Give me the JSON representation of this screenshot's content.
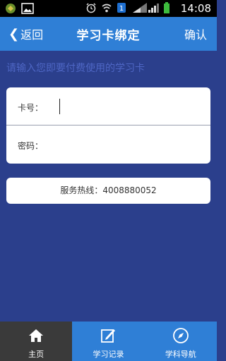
{
  "status_bar": {
    "time": "14:08",
    "icons": [
      "usb-debug-icon",
      "image-notification-icon",
      "alarm-icon",
      "wifi-icon",
      "notification-badge-icon",
      "signal-icon",
      "battery-icon"
    ]
  },
  "nav": {
    "back_label": "返回",
    "title": "学习卡绑定",
    "confirm_label": "确认"
  },
  "hint": "请输入您即要付费使用的学习卡",
  "form": {
    "card_label": "卡号：",
    "card_value": "",
    "password_label": "密码：",
    "password_value": ""
  },
  "hotline": "服务热线：4008880052",
  "tabs": [
    {
      "label": "主页",
      "icon": "home-icon",
      "active": true
    },
    {
      "label": "学习记录",
      "icon": "edit-note-icon",
      "active": false
    },
    {
      "label": "学科导航",
      "icon": "compass-icon",
      "active": false
    }
  ],
  "colors": {
    "background": "#2b3f8c",
    "nav_blue": "#2f7fd6",
    "hint_text": "#4e66c4",
    "active_tab": "#3a3a3a"
  }
}
